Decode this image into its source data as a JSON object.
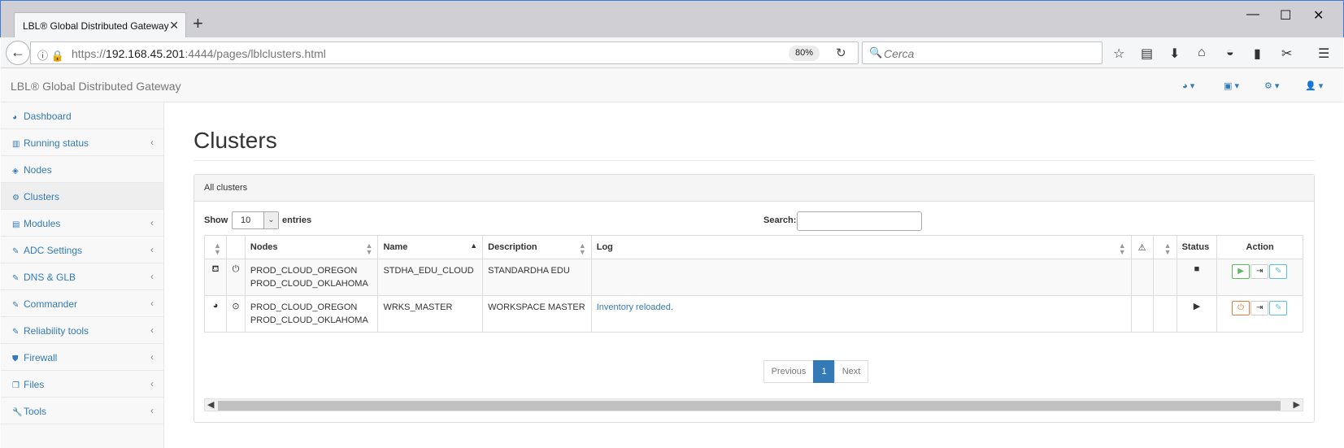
{
  "browser": {
    "tab_title": "LBL® Global Distributed Gateway",
    "url_prefix": "https://",
    "url_host": "192.168.45.201",
    "url_rest": ":4444/pages/lblclusters.html",
    "zoom": "80%",
    "search_placeholder": "Cerca"
  },
  "app": {
    "brand": "LBL® Global Distributed Gateway"
  },
  "sidebar": {
    "items": [
      {
        "label": "Dashboard",
        "icon": "dashboard-icon"
      },
      {
        "label": "Running status",
        "icon": "bar-chart-icon"
      },
      {
        "label": "Nodes",
        "icon": "cube-icon"
      },
      {
        "label": "Clusters",
        "icon": "cogs-icon"
      },
      {
        "label": "Modules",
        "icon": "list-alt-icon"
      },
      {
        "label": "ADC Settings",
        "icon": "edit-icon"
      },
      {
        "label": "DNS & GLB",
        "icon": "edit-icon"
      },
      {
        "label": "Commander",
        "icon": "edit-icon"
      },
      {
        "label": "Reliability tools",
        "icon": "edit-icon"
      },
      {
        "label": "Firewall",
        "icon": "shield-icon"
      },
      {
        "label": "Files",
        "icon": "files-icon"
      },
      {
        "label": "Tools",
        "icon": "wrench-icon"
      }
    ]
  },
  "main": {
    "title": "Clusters",
    "panel_heading": "All clusters",
    "show_label": "Show",
    "entries_value": "10",
    "entries_label": "entries",
    "search_label": "Search:",
    "table": {
      "headers": [
        "Nodes",
        "Name",
        "Description",
        "Log",
        "Status",
        "Action"
      ],
      "rows": [
        {
          "nodes": [
            "PROD_CLOUD_OREGON",
            "PROD_CLOUD_OKLAHOMA"
          ],
          "name": "STDHA_EDU_CLOUD",
          "description": "STANDARDHA EDU",
          "log": "",
          "status": "stopped"
        },
        {
          "nodes": [
            "PROD_CLOUD_OREGON",
            "PROD_CLOUD_OKLAHOMA"
          ],
          "name": "WRKS_MASTER",
          "description": "WORKSPACE MASTER",
          "log": "Inventory reloaded.",
          "status": "running"
        }
      ]
    },
    "pagination": {
      "previous": "Previous",
      "current": "1",
      "next": "Next"
    }
  }
}
